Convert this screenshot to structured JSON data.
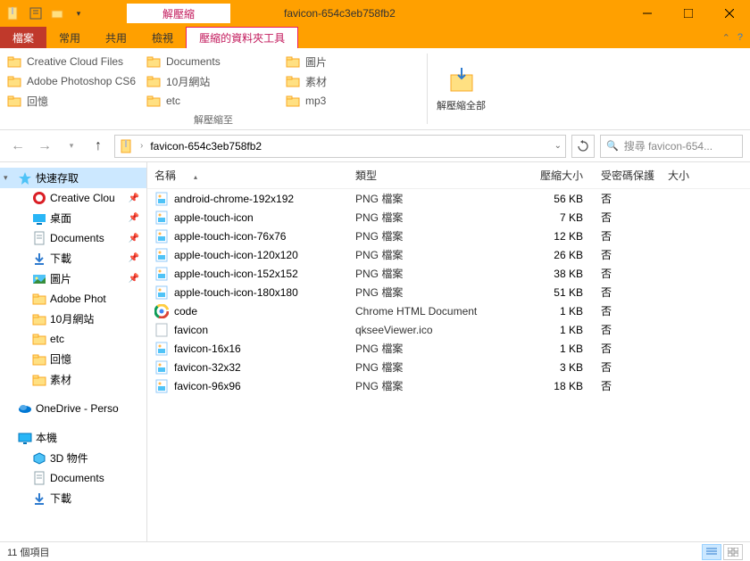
{
  "window": {
    "contextual_tab": "解壓縮",
    "title": "favicon-654c3eb758fb2"
  },
  "tabs": {
    "file": "檔案",
    "home": "常用",
    "share": "共用",
    "view": "檢視",
    "extract": "壓縮的資料夾工具"
  },
  "ribbon": {
    "dest": [
      "Creative Cloud Files",
      "Documents",
      "圖片",
      "Adobe Photoshop CS6",
      "10月網站",
      "素材",
      "回憶",
      "etc",
      "mp3"
    ],
    "extract_to_label": "解壓縮至",
    "extract_all_label": "解壓縮全部"
  },
  "nav": {
    "path": "favicon-654c3eb758fb2",
    "search_placeholder": "搜尋 favicon-654..."
  },
  "sidebar": [
    {
      "label": "快速存取",
      "icon": "star",
      "indent": 0,
      "expand": "▾",
      "selected": true
    },
    {
      "label": "Creative Clou",
      "icon": "cc",
      "indent": 1,
      "pin": true
    },
    {
      "label": "桌面",
      "icon": "desktop",
      "indent": 1,
      "pin": true
    },
    {
      "label": "Documents",
      "icon": "doc",
      "indent": 1,
      "pin": true
    },
    {
      "label": "下載",
      "icon": "download",
      "indent": 1,
      "pin": true
    },
    {
      "label": "圖片",
      "icon": "pictures",
      "indent": 1,
      "pin": true
    },
    {
      "label": "Adobe Phot",
      "icon": "folder",
      "indent": 1
    },
    {
      "label": "10月網站",
      "icon": "folder",
      "indent": 1
    },
    {
      "label": "etc",
      "icon": "folder",
      "indent": 1
    },
    {
      "label": "回憶",
      "icon": "folder",
      "indent": 1
    },
    {
      "label": "素材",
      "icon": "folder",
      "indent": 1
    },
    {
      "label": "OneDrive - Perso",
      "icon": "onedrive",
      "indent": 0,
      "expand": "",
      "gap": true
    },
    {
      "label": "本機",
      "icon": "pc",
      "indent": 0,
      "expand": "",
      "gap": true
    },
    {
      "label": "3D 物件",
      "icon": "3d",
      "indent": 1
    },
    {
      "label": "Documents",
      "icon": "doc",
      "indent": 1
    },
    {
      "label": "下載",
      "icon": "download",
      "indent": 1
    }
  ],
  "columns": {
    "name": "名稱",
    "type": "類型",
    "compressed": "壓縮大小",
    "password": "受密碼保護",
    "size": "大小"
  },
  "files": [
    {
      "name": "android-chrome-192x192",
      "type": "PNG 檔案",
      "size": "56 KB",
      "pwd": "否",
      "icon": "png"
    },
    {
      "name": "apple-touch-icon",
      "type": "PNG 檔案",
      "size": "7 KB",
      "pwd": "否",
      "icon": "png"
    },
    {
      "name": "apple-touch-icon-76x76",
      "type": "PNG 檔案",
      "size": "12 KB",
      "pwd": "否",
      "icon": "png"
    },
    {
      "name": "apple-touch-icon-120x120",
      "type": "PNG 檔案",
      "size": "26 KB",
      "pwd": "否",
      "icon": "png"
    },
    {
      "name": "apple-touch-icon-152x152",
      "type": "PNG 檔案",
      "size": "38 KB",
      "pwd": "否",
      "icon": "png"
    },
    {
      "name": "apple-touch-icon-180x180",
      "type": "PNG 檔案",
      "size": "51 KB",
      "pwd": "否",
      "icon": "png"
    },
    {
      "name": "code",
      "type": "Chrome HTML Document",
      "size": "1 KB",
      "pwd": "否",
      "icon": "chrome"
    },
    {
      "name": "favicon",
      "type": "qkseeViewer.ico",
      "size": "1 KB",
      "pwd": "否",
      "icon": "ico"
    },
    {
      "name": "favicon-16x16",
      "type": "PNG 檔案",
      "size": "1 KB",
      "pwd": "否",
      "icon": "png"
    },
    {
      "name": "favicon-32x32",
      "type": "PNG 檔案",
      "size": "3 KB",
      "pwd": "否",
      "icon": "png"
    },
    {
      "name": "favicon-96x96",
      "type": "PNG 檔案",
      "size": "18 KB",
      "pwd": "否",
      "icon": "png"
    }
  ],
  "status": {
    "count": "11 個項目"
  }
}
